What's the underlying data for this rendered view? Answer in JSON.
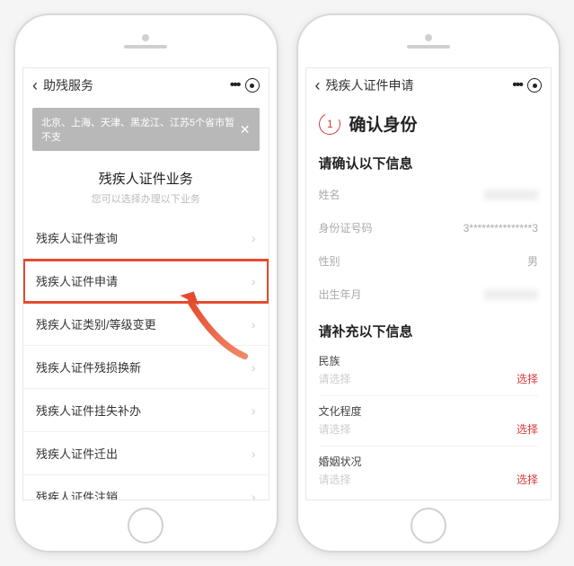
{
  "left": {
    "nav_title": "助残服务",
    "banner_text": "北京、上海、天津、黑龙江、江苏5个省市暂不支",
    "section_title": "残疾人证件业务",
    "section_sub": "您可以选择办理以下业务",
    "menu": [
      {
        "label": "残疾人证件查询"
      },
      {
        "label": "残疾人证件申请",
        "highlight": true
      },
      {
        "label": "残疾人证类别/等级变更"
      },
      {
        "label": "残疾人证件残损换新"
      },
      {
        "label": "残疾人证件挂失补办"
      },
      {
        "label": "残疾人证件迁出"
      },
      {
        "label": "残疾人证件注销"
      }
    ]
  },
  "right": {
    "nav_title": "残疾人证件申请",
    "step_number": "1",
    "step_title": "确认身份",
    "confirm_title": "请确认以下信息",
    "confirm_rows": [
      {
        "label": "姓名",
        "value": ""
      },
      {
        "label": "身份证号码",
        "value": "3***************3"
      },
      {
        "label": "性别",
        "value": "男"
      },
      {
        "label": "出生年月",
        "value": ""
      }
    ],
    "supp_title": "请补充以下信息",
    "supp_placeholder": "请选择",
    "supp_action": "选择",
    "supp_rows": [
      {
        "label": "民族"
      },
      {
        "label": "文化程度"
      },
      {
        "label": "婚姻状况"
      }
    ]
  }
}
